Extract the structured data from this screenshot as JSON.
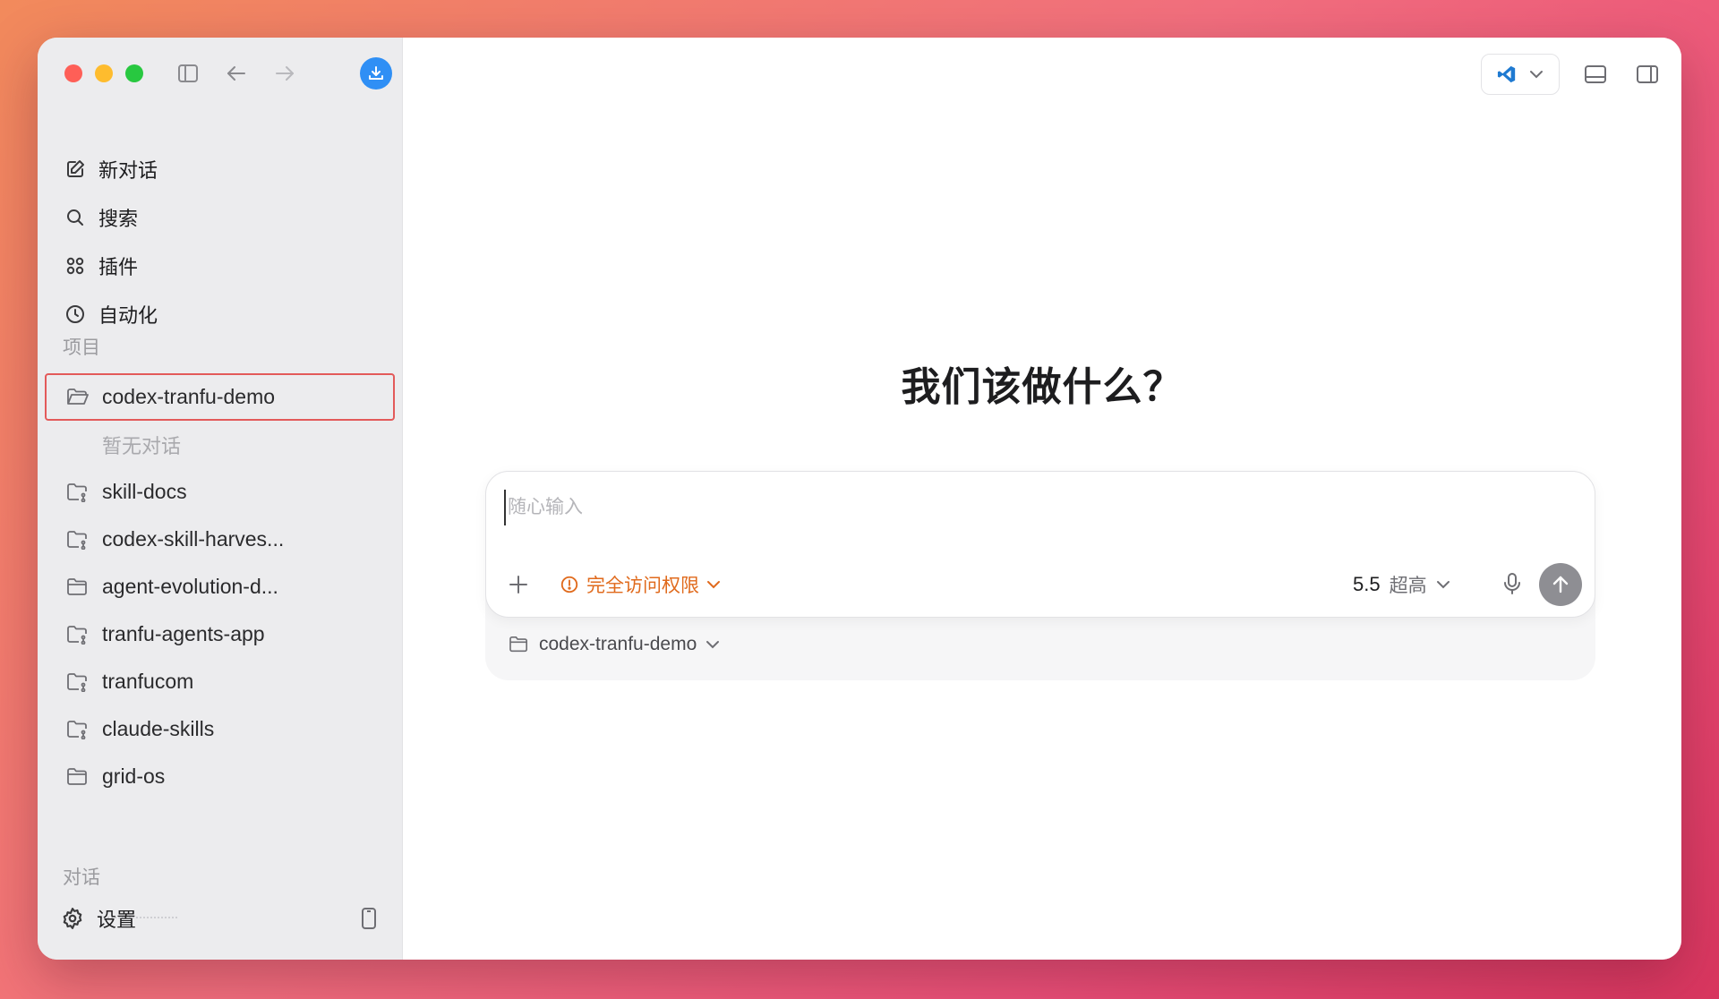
{
  "sidebar": {
    "nav": [
      {
        "label": "新对话",
        "icon": "edit-icon"
      },
      {
        "label": "搜索",
        "icon": "search-icon"
      },
      {
        "label": "插件",
        "icon": "plugins-icon"
      },
      {
        "label": "自动化",
        "icon": "clock-icon"
      }
    ],
    "projects_label": "项目",
    "projects": [
      {
        "label": "codex-tranfu-demo",
        "selected": true,
        "icon": "folder-open-icon"
      },
      {
        "label": "暂无对话",
        "empty": true
      },
      {
        "label": "skill-docs",
        "icon": "folder-branch-icon"
      },
      {
        "label": "codex-skill-harves...",
        "icon": "folder-branch-icon"
      },
      {
        "label": "agent-evolution-d...",
        "icon": "folder-icon"
      },
      {
        "label": "tranfu-agents-app",
        "icon": "folder-branch-icon"
      },
      {
        "label": "tranfucom",
        "icon": "folder-branch-icon"
      },
      {
        "label": "claude-skills",
        "icon": "folder-branch-icon"
      },
      {
        "label": "grid-os",
        "icon": "folder-icon"
      }
    ],
    "conversations_label": "对话",
    "settings_label": "设置"
  },
  "main": {
    "headline": "我们该做什么？",
    "composer": {
      "placeholder": "随心输入",
      "value": "",
      "permission_label": "完全访问权限",
      "model_version": "5.5",
      "model_level": "超高",
      "folder_label": "codex-tranfu-demo"
    }
  },
  "colors": {
    "accent_blue": "#2f8ff5",
    "permission_orange": "#e06a1c",
    "selection_red": "#e35a5a"
  }
}
